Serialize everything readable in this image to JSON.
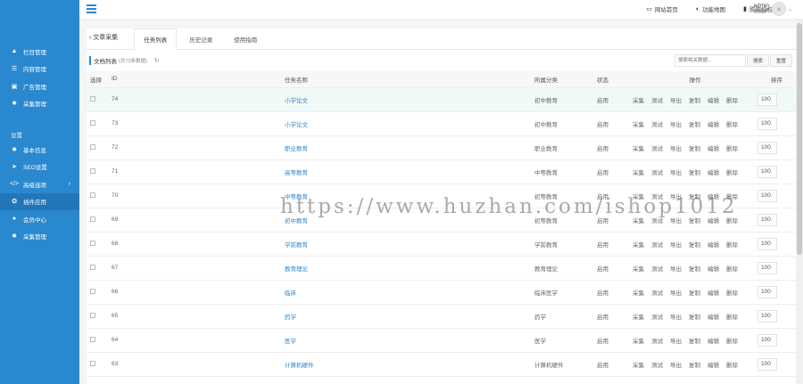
{
  "sidebar": {
    "items": [
      {
        "label": "栏目管理",
        "icon": "sitemap-icon"
      },
      {
        "label": "内容管理",
        "icon": "list-icon"
      },
      {
        "label": "广告管理",
        "icon": "image-icon"
      },
      {
        "label": "采集管理",
        "icon": "gear-icon"
      }
    ],
    "section_label": "设置",
    "settings_items": [
      {
        "label": "基本信息",
        "icon": "gear-icon"
      },
      {
        "label": "SEO设置",
        "icon": "send-icon"
      },
      {
        "label": "高级选项",
        "icon": "code-icon"
      },
      {
        "label": "插件应用",
        "icon": "globe-icon"
      },
      {
        "label": "会员中心",
        "icon": "user-icon"
      },
      {
        "label": "采集管理",
        "icon": "gear-icon"
      }
    ],
    "accent_color": "#2a88cf"
  },
  "topbar": {
    "links": [
      {
        "label": "网站首页",
        "icon": "monitor-icon"
      },
      {
        "label": "功能地图",
        "icon": "contrast-icon"
      },
      {
        "label": "购买授权",
        "icon": "bookmark-icon"
      }
    ],
    "user": {
      "name": "admin",
      "role": "创始人"
    }
  },
  "page": {
    "back_label": "文章采集",
    "tabs": [
      "任务列表",
      "历史记录",
      "使用指南"
    ],
    "list_title": "文档列表",
    "list_count": "(共73条数据)",
    "search_placeholder": "搜索相关数据...",
    "search_button": "搜索",
    "reset_button": "重置"
  },
  "table": {
    "headers": {
      "select": "选择",
      "id": "ID",
      "name": "任务名称",
      "category": "所属分类",
      "status": "状态",
      "ops": "操作",
      "order": "排序"
    },
    "ops": [
      "采集",
      "测试",
      "导出",
      "复制",
      "编辑",
      "删除"
    ],
    "rows": [
      {
        "id": "74",
        "name": "小学论文",
        "category": "初中教育",
        "status": "启用",
        "order": "100"
      },
      {
        "id": "73",
        "name": "小学论文",
        "category": "初中教育",
        "status": "启用",
        "order": "100"
      },
      {
        "id": "72",
        "name": "职业教育",
        "category": "职业教育",
        "status": "启用",
        "order": "100"
      },
      {
        "id": "71",
        "name": "高等教育",
        "category": "中等教育",
        "status": "启用",
        "order": "100"
      },
      {
        "id": "70",
        "name": "中等教育",
        "category": "初等教育",
        "status": "启用",
        "order": "100"
      },
      {
        "id": "69",
        "name": "初中教育",
        "category": "初等教育",
        "status": "启用",
        "order": "100"
      },
      {
        "id": "68",
        "name": "学前教育",
        "category": "学前教育",
        "status": "启用",
        "order": "100"
      },
      {
        "id": "67",
        "name": "教育理论",
        "category": "教育理论",
        "status": "启用",
        "order": "100"
      },
      {
        "id": "66",
        "name": "临床",
        "category": "临床医学",
        "status": "启用",
        "order": "100"
      },
      {
        "id": "65",
        "name": "药学",
        "category": "药学",
        "status": "启用",
        "order": "100"
      },
      {
        "id": "64",
        "name": "医学",
        "category": "医学",
        "status": "启用",
        "order": "100"
      },
      {
        "id": "63",
        "name": "计算机硬件",
        "category": "计算机硬件",
        "status": "启用",
        "order": "100"
      }
    ]
  },
  "watermark": "https://www.huzhan.com/ishop1012"
}
